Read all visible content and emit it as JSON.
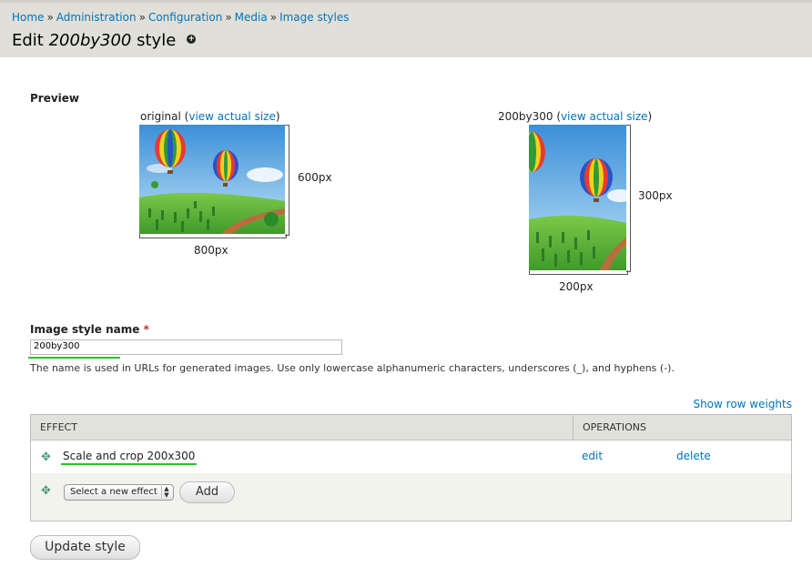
{
  "breadcrumb": {
    "items": [
      "Home",
      "Administration",
      "Configuration",
      "Media",
      "Image styles"
    ],
    "separator": "»"
  },
  "title": {
    "prefix": "Edit",
    "name": "200by300",
    "suffix": "style",
    "shortcut_icon": "add-shortcut-icon"
  },
  "preview": {
    "label": "Preview",
    "original": {
      "caption_prefix": "original (",
      "link": "view actual size",
      "caption_suffix": ")",
      "width_label": "800px",
      "height_label": "600px"
    },
    "styled": {
      "caption_prefix": "200by300 (",
      "link": "view actual size",
      "caption_suffix": ")",
      "width_label": "200px",
      "height_label": "300px"
    }
  },
  "name_field": {
    "label": "Image style name",
    "required_mark": "*",
    "value": "200by300",
    "description": "The name is used in URLs for generated images. Use only lowercase alphanumeric characters, underscores (_), and hyphens (-)."
  },
  "effects": {
    "row_weights_link": "Show row weights",
    "columns": [
      "EFFECT",
      "OPERATIONS"
    ],
    "rows": [
      {
        "effect": "Scale and crop 200x300",
        "edit": "edit",
        "delete": "delete"
      }
    ],
    "new_effect_select": "Select a new effect",
    "add_button": "Add"
  },
  "update_button": "Update style",
  "colors": {
    "link": "#0074bd",
    "highlight_underline": "#2ec02e",
    "header_bg": "#e0e0d8"
  }
}
